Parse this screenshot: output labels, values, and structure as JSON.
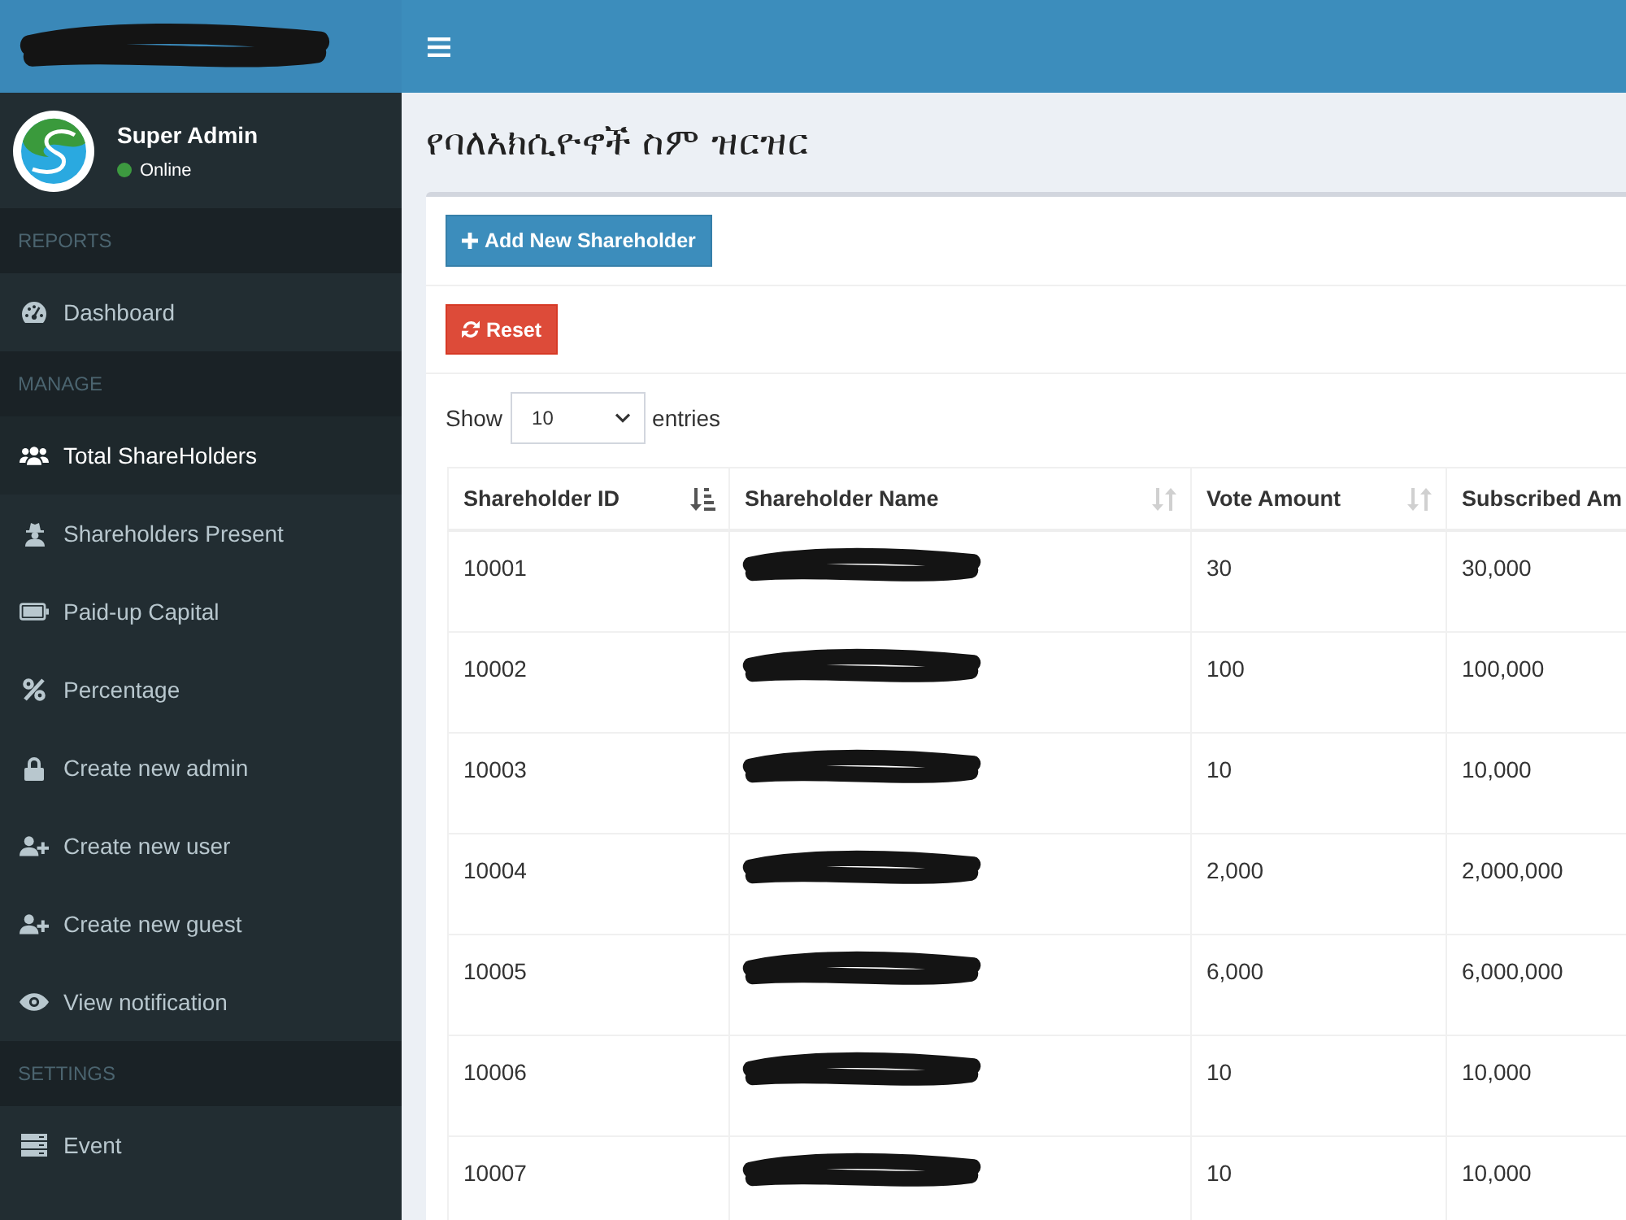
{
  "sidebar": {
    "logo": {
      "redacted": true
    },
    "user": {
      "name": "Super Admin",
      "status": "Online",
      "online": true
    },
    "sections": [
      {
        "header": "REPORTS",
        "items": [
          {
            "label": "Dashboard",
            "selected": false
          }
        ]
      },
      {
        "header": "MANAGE",
        "items": [
          {
            "label": "Total ShareHolders",
            "selected": true
          },
          {
            "label": "Shareholders Present",
            "selected": false
          },
          {
            "label": "Paid-up Capital",
            "selected": false
          },
          {
            "label": "Percentage",
            "selected": false
          },
          {
            "label": "Create new admin",
            "selected": false
          },
          {
            "label": "Create new user",
            "selected": false
          },
          {
            "label": "Create new guest",
            "selected": false
          },
          {
            "label": "View notification",
            "selected": false
          }
        ]
      },
      {
        "header": "SETTINGS",
        "items": [
          {
            "label": "Event",
            "selected": false
          }
        ]
      }
    ]
  },
  "page": {
    "title": "የባለአክሲዮኖች ስም ዝርዝር"
  },
  "toolbar": {
    "add_button": "Add New Shareholder",
    "reset_button": "Reset"
  },
  "length_menu": {
    "before": "Show",
    "value": "10",
    "after": "entries"
  },
  "table": {
    "columns": [
      {
        "label": "Shareholder ID",
        "sorted": true
      },
      {
        "label": "Shareholder Name",
        "sorted": false
      },
      {
        "label": "Vote Amount",
        "sorted": false
      },
      {
        "label": "Subscribed Am"
      }
    ],
    "rows": [
      {
        "id": "10001",
        "name_redacted": true,
        "vote_amount": "30",
        "subscribed_amount": "30,000"
      },
      {
        "id": "10002",
        "name_redacted": true,
        "vote_amount": "100",
        "subscribed_amount": "100,000"
      },
      {
        "id": "10003",
        "name_redacted": true,
        "vote_amount": "10",
        "subscribed_amount": "10,000"
      },
      {
        "id": "10004",
        "name_redacted": true,
        "vote_amount": "2,000",
        "subscribed_amount": "2,000,000"
      },
      {
        "id": "10005",
        "name_redacted": true,
        "vote_amount": "6,000",
        "subscribed_amount": "6,000,000"
      },
      {
        "id": "10006",
        "name_redacted": true,
        "vote_amount": "10",
        "subscribed_amount": "10,000"
      },
      {
        "id": "10007",
        "name_redacted": true,
        "vote_amount": "10",
        "subscribed_amount": "10,000"
      }
    ]
  }
}
